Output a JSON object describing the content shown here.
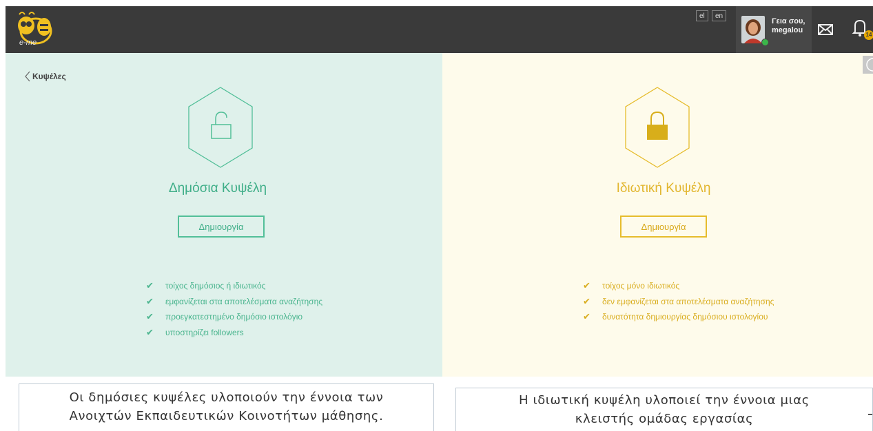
{
  "header": {
    "logo_text": "e-me",
    "languages": [
      "el",
      "en"
    ],
    "user": {
      "greeting": "Γεια σου,",
      "username": "megalou"
    },
    "notifications_count": "14"
  },
  "nav": {
    "back_label": "Κυψέλες"
  },
  "public_hive": {
    "title": "Δημόσια Κυψέλη",
    "button_label": "Δημιουργία",
    "features": [
      "τοίχος δημόσιος ή ιδιωτικός",
      "εμφανίζεται στα αποτελέσματα αναζήτησης",
      "προεγκατεστημένο δημόσιο ιστολόγιο",
      "υποστηρίζει followers"
    ]
  },
  "private_hive": {
    "title": "Ιδιωτική Κυψέλη",
    "button_label": "Δημιουργία",
    "features": [
      "τοίχος μόνο ιδιωτικός",
      "δεν εμφανίζεται στα αποτελέσματα αναζήτησης",
      "δυνατότητα δημιουργίας δημόσιου ιστολογίου"
    ]
  },
  "captions": {
    "left_line1": "Οι δημόσιες κυψέλες υλοποιούν την έννοια των",
    "left_line2": "Ανοιχτών Εκπαιδευτικών Κοινοτήτων μάθησης.",
    "right_line1": "Η ιδιωτική κυψέλη υλοποιεί την έννοια μιας",
    "right_line2": "κλειστής ομάδας εργασίας"
  },
  "colors": {
    "topbar": "#3a3a3a",
    "public_bg": "#dff1eb",
    "public_accent": "#52bf98",
    "private_bg": "#fefbeb",
    "private_accent": "#e6bc2c"
  },
  "icons": {
    "logo": "bee-logo-icon",
    "mail": "mail-icon",
    "bell": "bell-icon",
    "back": "chevron-left-icon",
    "public_lock": "unlocked-padlock-icon",
    "private_lock": "locked-padlock-icon",
    "check": "check-icon"
  }
}
